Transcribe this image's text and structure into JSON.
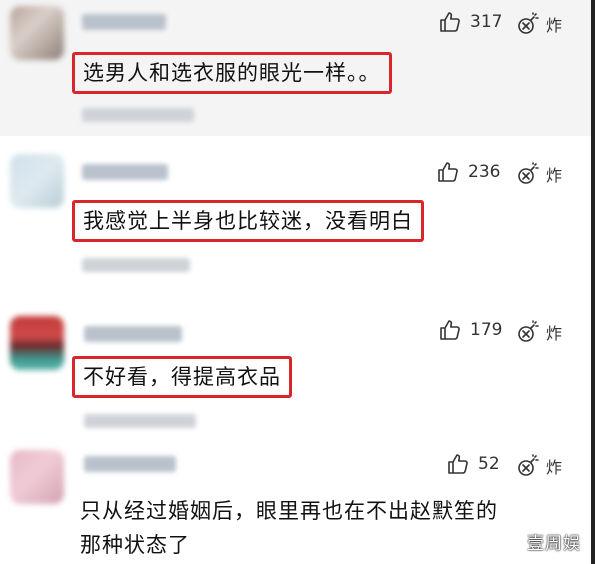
{
  "comments": [
    {
      "likes": "317",
      "zha_label": "炸",
      "text": "选男人和选衣服的眼光一样。。",
      "highlighted": true
    },
    {
      "likes": "236",
      "zha_label": "炸",
      "text": "我感觉上半身也比较迷，没看明白",
      "highlighted": true
    },
    {
      "likes": "179",
      "zha_label": "炸",
      "text": "不好看，得提高衣品",
      "highlighted": true
    },
    {
      "likes": "52",
      "zha_label": "炸",
      "text_lines": [
        "只从经过婚姻后，眼里再也在不出赵默笙的",
        "那种状态了"
      ],
      "highlighted": false
    }
  ],
  "watermark": "壹周娱",
  "icons": {
    "like": "thumbs-up-icon",
    "zha": "bomb-icon"
  },
  "colors": {
    "highlight_border": "#d8262c",
    "first_bg": "#f4f4f4"
  }
}
